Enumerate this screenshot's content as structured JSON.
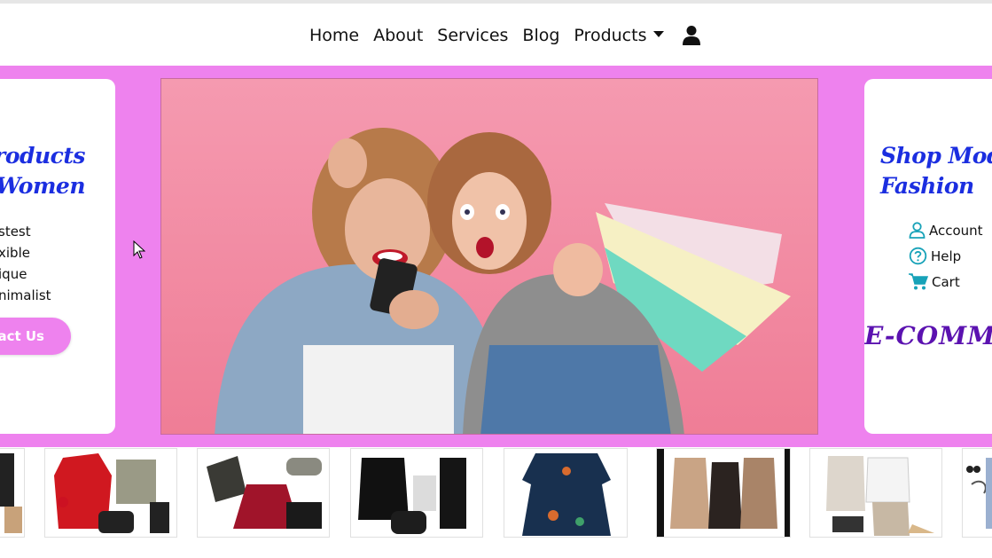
{
  "nav": {
    "items": [
      "Home",
      "About",
      "Services",
      "Blog"
    ],
    "products_label": "Products",
    "user_icon": "user-icon"
  },
  "banner": {
    "background": "#ee82ee",
    "left_card": {
      "title_line1": "n Products",
      "title_line2": "Women",
      "features": [
        "stest",
        "xible",
        "ique",
        "nimalist"
      ],
      "contact_label": "ntact Us"
    },
    "right_card": {
      "title_line1": "Shop Modern",
      "title_line2": "Fashion",
      "links": [
        {
          "label": "Account",
          "icon": "person-icon"
        },
        {
          "label": "Help",
          "icon": "question-circle-icon"
        },
        {
          "label": "Cart",
          "icon": "cart-icon"
        }
      ],
      "brand_text": "E-COMMERCE"
    },
    "hero_background": "#f08ba8"
  },
  "strip": {
    "thumbnails": [
      "outfit-1",
      "outfit-2",
      "outfit-3",
      "outfit-4",
      "outfit-5",
      "outfit-6",
      "outfit-7",
      "outfit-8"
    ]
  },
  "colors": {
    "accent": "#ee82ee",
    "title_blue": "#1b2ee0",
    "icon_teal": "#17a2b8",
    "brand_purple": "#5b12b0"
  }
}
